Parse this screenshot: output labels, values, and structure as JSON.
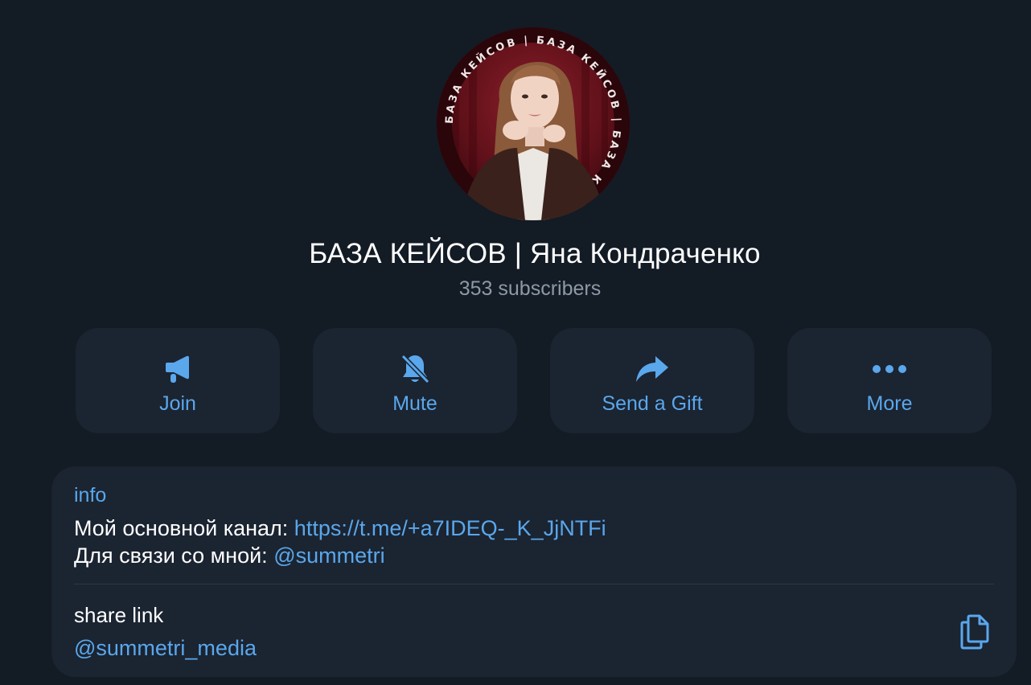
{
  "channel": {
    "title": "БАЗА КЕЙСОВ | Яна Кондраченко",
    "subscribers": "353 subscribers",
    "avatar_ring_text": "БАЗА КЕЙСОВ | БАЗА КЕЙСОВ | БАЗА КЕЙСОВ |"
  },
  "actions": [
    {
      "label": "Join",
      "icon": "megaphone-icon"
    },
    {
      "label": "Mute",
      "icon": "bell-slash-icon"
    },
    {
      "label": "Send a Gift",
      "icon": "share-arrow-icon"
    },
    {
      "label": "More",
      "icon": "ellipsis-icon"
    }
  ],
  "info": {
    "section_label": "info",
    "line1_prefix": "Мой основной канал: ",
    "line1_link": "https://t.me/+a7IDEQ-_K_JjNTFi",
    "line2_prefix": "Для связи со мной: ",
    "line2_link": "@summetri",
    "share_label": "share link",
    "share_value": "@summetri_media",
    "copy_icon": "copy-icon"
  },
  "colors": {
    "background": "#131b25",
    "card": "#1b2431",
    "accent": "#5aa7ec",
    "muted": "#8d99a7"
  }
}
